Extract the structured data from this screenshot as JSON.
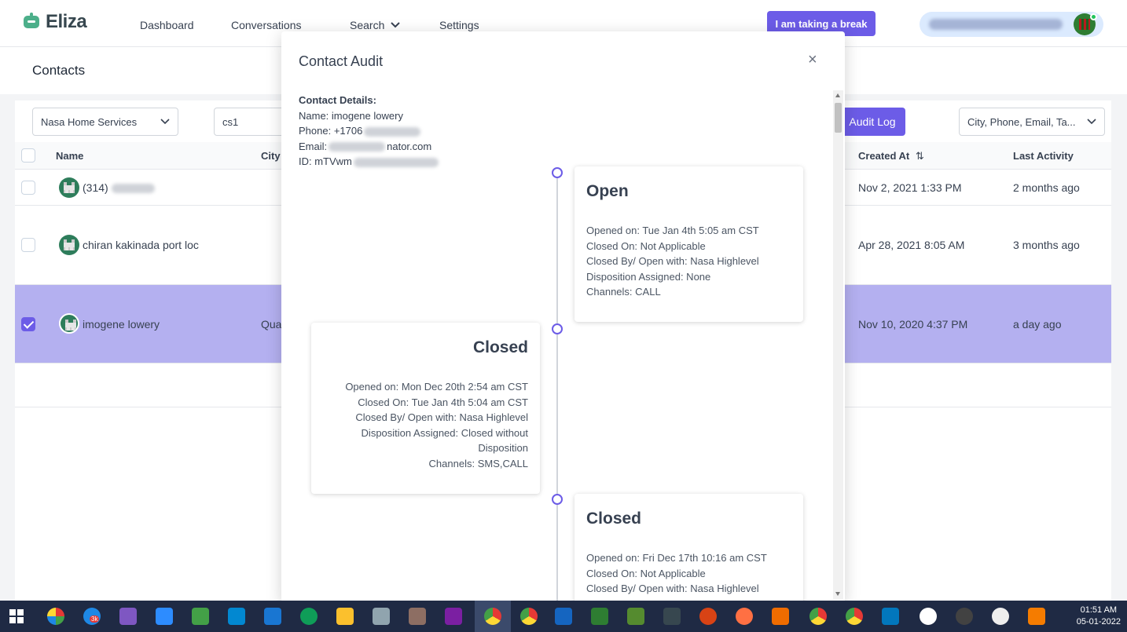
{
  "app": {
    "name": "Eliza",
    "nav": [
      "Dashboard",
      "Conversations",
      "Search",
      "Settings"
    ],
    "break_button": "I am taking a break"
  },
  "page": {
    "title": "Contacts",
    "location_select": "Nasa Home Services",
    "search_value": "cs1",
    "audit_log_button": "Audit Log",
    "filter_select": "City, Phone, Email, Ta..."
  },
  "table": {
    "headers": {
      "name": "Name",
      "city": "City",
      "created_at": "Created At",
      "last_activity": "Last Activity",
      "sort_icon": "⇅"
    },
    "rows": [
      {
        "name": "(314)",
        "city": "",
        "created_at": "Nov 2, 2021 1:33 PM",
        "last_activity": "2 months ago",
        "selected": false
      },
      {
        "name": "chiran kakinada port loc",
        "city": "",
        "created_at": "Apr 28, 2021 8:05 AM",
        "last_activity": "3 months ago",
        "selected": false
      },
      {
        "name": "imogene lowery",
        "city": "Qua",
        "created_at": "Nov 10, 2020 4:37 PM",
        "last_activity": "a day ago",
        "selected": true
      }
    ]
  },
  "modal": {
    "title": "Contact Audit",
    "close": "×",
    "details": {
      "heading": "Contact Details:",
      "name": "Name: imogene lowery",
      "phone": "Phone: +1706",
      "email_prefix": "Email:",
      "email_suffix": "nator.com",
      "id": "ID: mTVwm"
    },
    "events": [
      {
        "status": "Open",
        "side": "right",
        "opened_on": "Opened on: Tue Jan 4th 5:05 am CST",
        "closed_on": "Closed On: Not Applicable",
        "closed_by": "Closed By/ Open with: Nasa Highlevel",
        "disposition": "Disposition Assigned: None",
        "channels": "Channels: CALL"
      },
      {
        "status": "Closed",
        "side": "left",
        "opened_on": "Opened on: Mon Dec 20th 2:54 am CST",
        "closed_on": "Closed On: Tue Jan 4th 5:04 am CST",
        "closed_by": "Closed By/ Open with: Nasa Highlevel",
        "disposition": "Disposition Assigned: Closed without Disposition",
        "channels": "Channels: SMS,CALL"
      },
      {
        "status": "Closed",
        "side": "right",
        "opened_on": "Opened on: Fri Dec 17th 10:16 am CST",
        "closed_on": "Closed On: Not Applicable",
        "closed_by": "Closed By/ Open with: Nasa Highlevel"
      }
    ]
  },
  "taskbar": {
    "time": "01:51 AM",
    "date": "05-01-2022",
    "badge": "3k"
  },
  "colors": {
    "accent": "#6c5ce7",
    "selected_row": "#b4b0f0",
    "logo_green": "#4caf8a",
    "taskbar": "#1f2a44"
  }
}
